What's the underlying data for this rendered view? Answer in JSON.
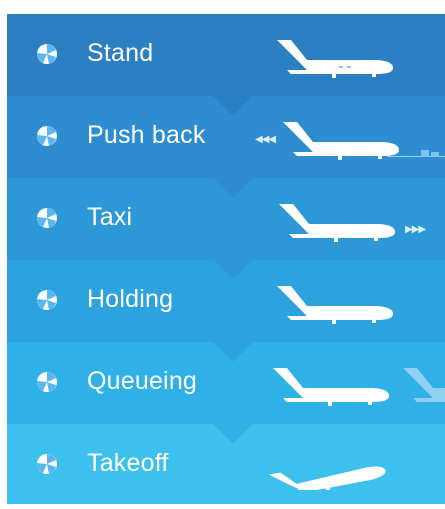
{
  "stages": [
    {
      "label": "Stand",
      "color": "#2d7fc4",
      "icon": "pie-chart-icon"
    },
    {
      "label": "Push back",
      "color": "#2e8cd0",
      "icon": "pie-chart-icon"
    },
    {
      "label": "Taxi",
      "color": "#2c98d8",
      "icon": "pie-chart-icon"
    },
    {
      "label": "Holding",
      "color": "#2ca3de",
      "icon": "pie-chart-icon"
    },
    {
      "label": "Queueing",
      "color": "#2fb0e6",
      "icon": "pie-chart-icon"
    },
    {
      "label": "Takeoff",
      "color": "#3cc0ed",
      "icon": "pie-chart-icon"
    }
  ]
}
